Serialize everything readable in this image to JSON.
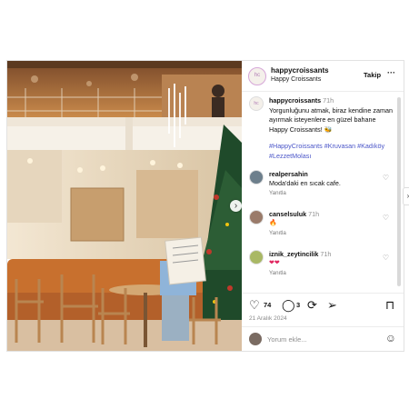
{
  "account": {
    "username": "happycroissants",
    "display_name": "Happy Croissants",
    "follow_label": "Takip",
    "more_label": "···",
    "avatar_text": "hc"
  },
  "caption": {
    "username": "happycroissants",
    "time": "71h",
    "text": "Yorgunluğunu atmak, biraz kendine zaman ayırmak isteyenlere en güzel bahane Happy Croissants! 🐝",
    "hashtags": "#HappyCroissants #Kruvasan #Kadıköy #LezzetMolası"
  },
  "comments": [
    {
      "username": "realpersahin",
      "time": "",
      "text": "Moda'daki en sıcak cafe.",
      "reply_label": "Yanıtla"
    },
    {
      "username": "canselsuluk",
      "time": "71h",
      "text": "🔥",
      "reply_label": "Yanıtla"
    },
    {
      "username": "iznik_zeytincilik",
      "time": "71h",
      "text": "❤❤",
      "reply_label": "Yanıtla"
    }
  ],
  "actions": {
    "like_count": "74",
    "comment_count": "3",
    "icons": [
      "heart-icon",
      "comment-icon",
      "repost-icon",
      "share-icon",
      "bookmark-icon"
    ]
  },
  "post_date": "21 Aralık 2024",
  "add_comment_placeholder": "Yorum ekle...",
  "colors": {
    "hashtag": "#4a55c8",
    "border": "#e2e2e2",
    "muted": "#8e8e8e"
  }
}
